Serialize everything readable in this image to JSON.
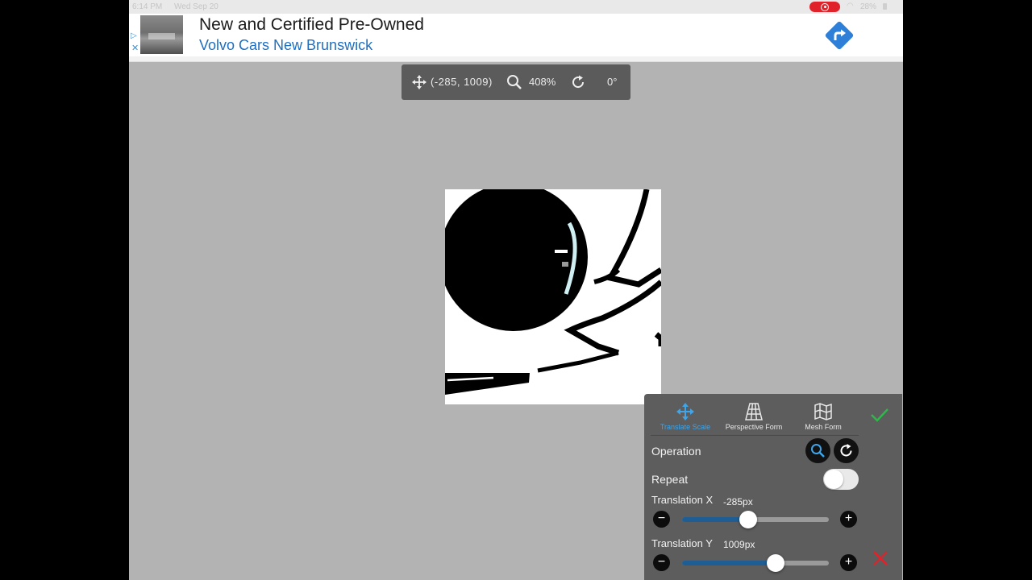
{
  "status_bar": {
    "time": "6:14 PM",
    "date": "Wed Sep 20",
    "battery": "28%"
  },
  "ad": {
    "headline": "New and Certified Pre-Owned",
    "advertiser": "Volvo Cars New Brunswick"
  },
  "transform_toolbar": {
    "position": "(-285,  1009)",
    "zoom": "408%",
    "rotation": "0°"
  },
  "panel": {
    "tabs": [
      {
        "label": "Translate Scale",
        "icon": "translate-icon",
        "active": true
      },
      {
        "label": "Perspective Form",
        "icon": "perspective-icon",
        "active": false
      },
      {
        "label": "Mesh Form",
        "icon": "mesh-icon",
        "active": false
      }
    ],
    "operation_label": "Operation",
    "repeat_label": "Repeat",
    "repeat_on": false,
    "translation_x": {
      "label": "Translation X",
      "value": "-285px",
      "fill": 0.45
    },
    "translation_y": {
      "label": "Translation Y",
      "value": "1009px",
      "fill": 0.64
    }
  },
  "colors": {
    "accent": "#3fa4e8",
    "confirm": "#2db84a",
    "cancel": "#e0232b",
    "slider_fill": "#1f5e95"
  }
}
